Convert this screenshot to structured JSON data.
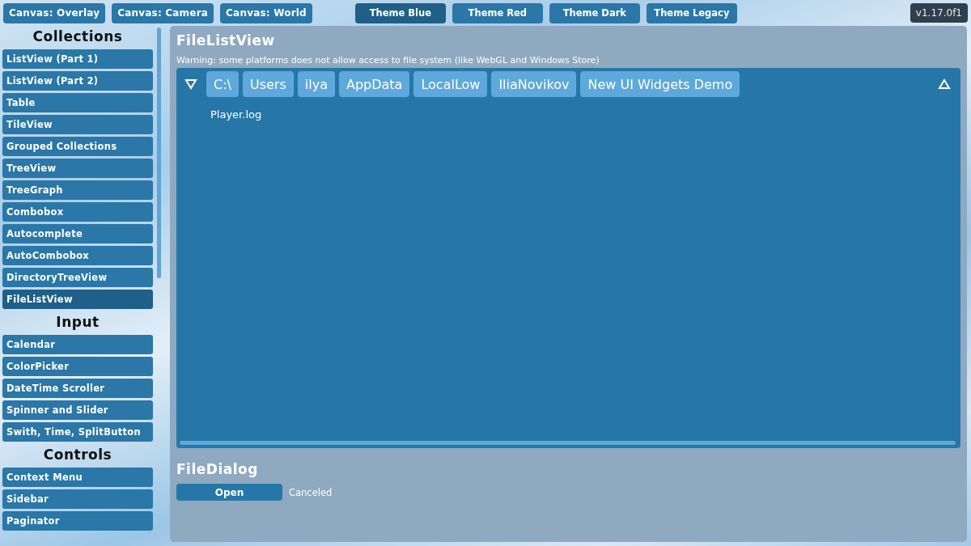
{
  "canvas_buttons": [
    {
      "label": "Canvas: Overlay"
    },
    {
      "label": "Canvas: Camera"
    },
    {
      "label": "Canvas: World"
    }
  ],
  "themes": [
    {
      "label": "Theme Blue",
      "selected": true
    },
    {
      "label": "Theme Red",
      "selected": false
    },
    {
      "label": "Theme Dark",
      "selected": false
    },
    {
      "label": "Theme Legacy",
      "selected": false
    }
  ],
  "version": "v1.17.0f1",
  "sidebar": [
    {
      "title": "Collections",
      "items": [
        {
          "label": "ListView (Part 1)",
          "selected": false
        },
        {
          "label": "ListView (Part 2)",
          "selected": false
        },
        {
          "label": "Table",
          "selected": false
        },
        {
          "label": "TileView",
          "selected": false
        },
        {
          "label": "Grouped Collections",
          "selected": false
        },
        {
          "label": "TreeView",
          "selected": false
        },
        {
          "label": "TreeGraph",
          "selected": false
        },
        {
          "label": "Combobox",
          "selected": false
        },
        {
          "label": "Autocomplete",
          "selected": false
        },
        {
          "label": "AutoCombobox",
          "selected": false
        },
        {
          "label": "DirectoryTreeView",
          "selected": false
        },
        {
          "label": "FileListView",
          "selected": true
        }
      ]
    },
    {
      "title": "Input",
      "items": [
        {
          "label": "Calendar",
          "selected": false
        },
        {
          "label": "ColorPicker",
          "selected": false
        },
        {
          "label": "DateTime Scroller",
          "selected": false
        },
        {
          "label": "Spinner and Slider",
          "selected": false
        },
        {
          "label": "Swith, Time, SplitButton",
          "selected": false
        }
      ]
    },
    {
      "title": "Controls",
      "items": [
        {
          "label": "Context Menu",
          "selected": false
        },
        {
          "label": "Sidebar",
          "selected": false
        },
        {
          "label": "Paginator",
          "selected": false
        }
      ]
    }
  ],
  "file_list": {
    "title": "FileListView",
    "warning": "Warning: some platforms does not allow access to file system (like WebGL and Windows Store)",
    "path": [
      "C:\\",
      "Users",
      "ilya",
      "AppData",
      "LocalLow",
      "IliaNovikov",
      "New UI Widgets Demo"
    ],
    "files": [
      "Player.log"
    ]
  },
  "file_dialog": {
    "title": "FileDialog",
    "button": "Open",
    "result": "Canceled"
  }
}
